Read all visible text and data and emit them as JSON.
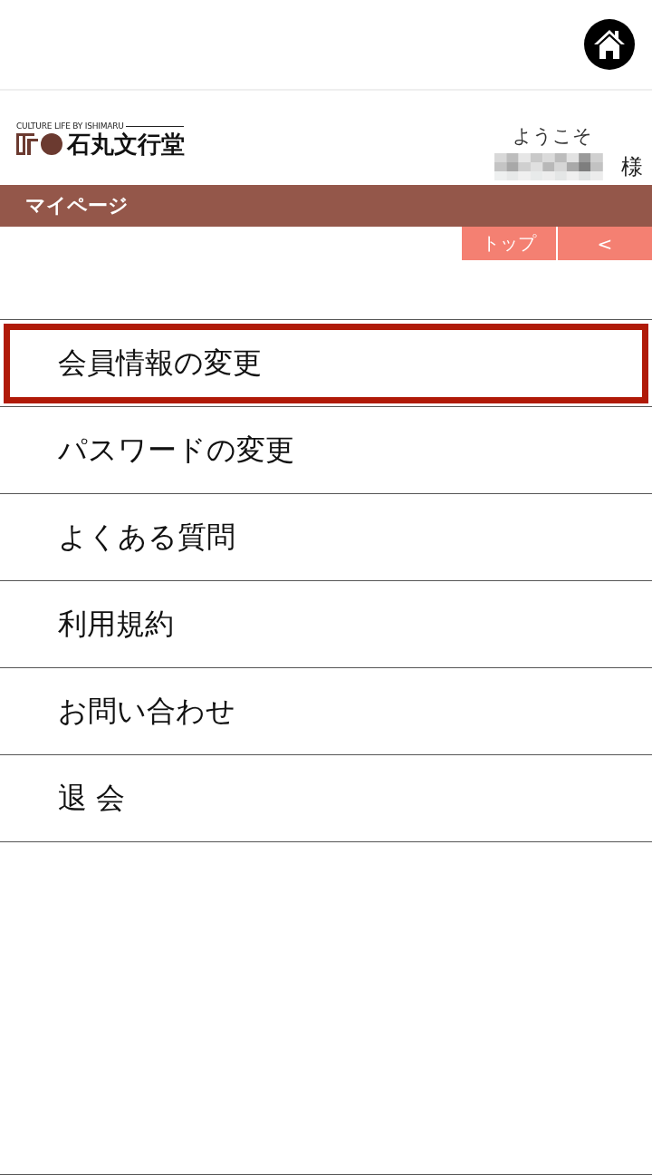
{
  "header": {
    "logo": {
      "tagline": "CULTURE LIFE BY ISHIMARU",
      "name": "石丸文行堂"
    },
    "welcome": "ようこそ",
    "honorific": "様"
  },
  "title_bar": {
    "title": "マイページ"
  },
  "nav_buttons": [
    {
      "label": "トップ"
    },
    {
      "label": "<"
    }
  ],
  "menu": [
    {
      "label": "会員情報の変更",
      "highlighted": true
    },
    {
      "label": "パスワードの変更",
      "highlighted": false
    },
    {
      "label": "よくある質問",
      "highlighted": false
    },
    {
      "label": "利用規約",
      "highlighted": false
    },
    {
      "label": "お問い合わせ",
      "highlighted": false
    },
    {
      "label": "退 会",
      "highlighted": false
    }
  ]
}
